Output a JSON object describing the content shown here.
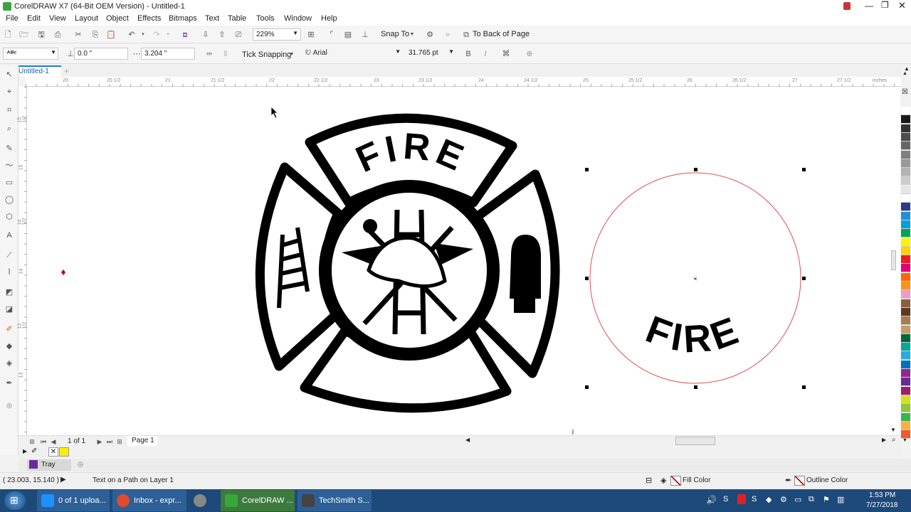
{
  "title": "CorelDRAW X7 (64-Bit OEM Version) - Untitled-1",
  "menu": [
    "File",
    "Edit",
    "View",
    "Layout",
    "Object",
    "Effects",
    "Bitmaps",
    "Text",
    "Table",
    "Tools",
    "Window",
    "Help"
  ],
  "toolbar": {
    "zoom": "229%",
    "snap_to": "Snap To",
    "to_back": "To Back of Page"
  },
  "propbar": {
    "preset": "ᴬᴮᶜ",
    "offset": "0.0 \"",
    "distance": "3.204 \"",
    "tick_snapping": "Tick Snapping",
    "font": "Arial",
    "font_size": "31.765 pt"
  },
  "doc_tab": "Untitled-1",
  "ruler": {
    "unit": "inches",
    "labels": [
      "20",
      "20 1/2",
      "21",
      "21 1/2",
      "22",
      "22 1/2",
      "23",
      "23 1/2",
      "24",
      "24 1/2",
      "25",
      "25 1/2",
      "26",
      "26 1/2",
      "27",
      "27 1/2"
    ],
    "vlabels": [
      "15 1/2",
      "15",
      "14 1/2",
      "14",
      "13 1/2",
      "13"
    ]
  },
  "artwork": {
    "logo_top_text": "FIRE",
    "path_text": "FIRE"
  },
  "pagebar": {
    "pages": "1 of 1",
    "page_tab": "Page 1"
  },
  "tray": "Tray",
  "status": {
    "coords": "( 23.003, 15.140 )",
    "info": "Text on a Path on Layer 1",
    "fill": "Fill Color",
    "outline": "Outline Color"
  },
  "taskbar": {
    "tasks": [
      {
        "label": "0 of 1 uploa...",
        "icon": "ie-icon",
        "color": "#1e90ff"
      },
      {
        "label": "Inbox - expr...",
        "icon": "chrome-icon",
        "color": "#e04a2f"
      },
      {
        "label": "",
        "icon": "app-icon",
        "color": "#888888"
      },
      {
        "label": "CorelDRAW ...",
        "icon": "coreldraw-icon",
        "color": "#3aa63a"
      },
      {
        "label": "TechSmith S...",
        "icon": "techsmith-icon",
        "color": "#444444"
      }
    ],
    "time": "1:53 PM",
    "date": "7/27/2018"
  },
  "palette_colors": [
    "#ffffff",
    "#1a1a1a",
    "#333333",
    "#4d4d4d",
    "#666666",
    "#808080",
    "#999999",
    "#b3b3b3",
    "#cccccc",
    "#e6e6e6",
    "#ffffff",
    "#2b3a8f",
    "#1f8fd6",
    "#00a0e0",
    "#00a650",
    "#fff200",
    "#ffd200",
    "#ed1c24",
    "#e2007a",
    "#ff6600",
    "#f7941d",
    "#f49ac1",
    "#8b5e3c",
    "#5c3a21",
    "#a67c52",
    "#c69c6d",
    "#006838",
    "#00a99d",
    "#29abe2",
    "#0072bc",
    "#92278f",
    "#662d91",
    "#9e1f63",
    "#d7df23",
    "#8dc63f",
    "#39b54a",
    "#fbb040",
    "#f15a29"
  ],
  "colors": {
    "accent": "#1d4a7a",
    "path_red": "#e05050",
    "selection": "#000000"
  }
}
